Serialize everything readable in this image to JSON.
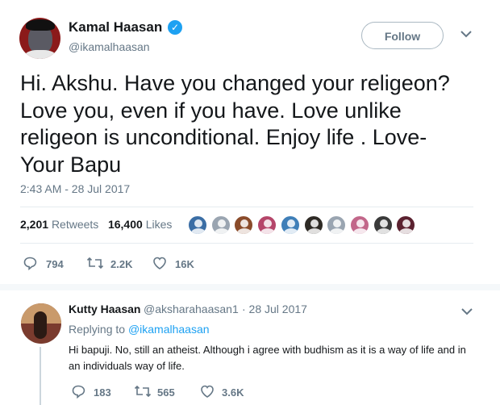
{
  "tweet": {
    "author_name": "Kamal Haasan",
    "author_handle": "@ikamalhaasan",
    "follow_label": "Follow",
    "text": "Hi. Akshu. Have you changed your religeon? Love you, even if you have. Love unlike religeon is unconditional. Enjoy life . Love- Your Bapu",
    "timestamp": "2:43 AM - 28 Jul 2017",
    "retweets_count": "2,201",
    "retweets_label": "Retweets",
    "likes_count": "16,400",
    "likes_label": "Likes",
    "actions": {
      "replies": "794",
      "retweets": "2.2K",
      "likes": "16K"
    }
  },
  "likers": [
    {
      "color": "#3b6ea5"
    },
    {
      "color": "#9aa5b1"
    },
    {
      "color": "#8a4b2a"
    },
    {
      "color": "#b5466a"
    },
    {
      "color": "#3f7fb8"
    },
    {
      "color": "#2e2a25"
    },
    {
      "color": "#9aa5b1"
    },
    {
      "color": "#c2678a"
    },
    {
      "color": "#3a3a3a"
    },
    {
      "color": "#5b2230"
    }
  ],
  "reply": {
    "author_name": "Kutty Haasan",
    "author_handle": "@aksharahaasan1",
    "date": "· 28 Jul 2017",
    "replying_label": "Replying to",
    "replying_to": "@ikamalhaasan",
    "text": "Hi bapuji. No, still an atheist. Although i agree with budhism as it is a way of life and in an individuals way of life.",
    "actions": {
      "replies": "183",
      "retweets": "565",
      "likes": "3.6K"
    }
  },
  "colors": {
    "accent": "#1da1f2",
    "muted": "#657786",
    "text": "#14171a"
  }
}
